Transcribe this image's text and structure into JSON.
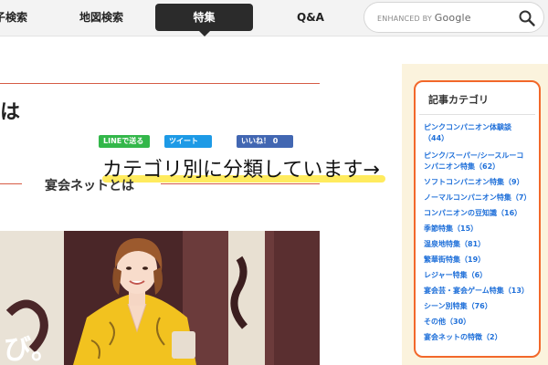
{
  "nav": {
    "items": [
      "子検索",
      "地図検索",
      "特集",
      "Q&A"
    ],
    "active": "特集"
  },
  "search": {
    "label_prefix": "ENHANCED BY",
    "label_brand": "Google",
    "icon": "search-icon"
  },
  "article": {
    "title_fragment": "は",
    "sns": {
      "line": "LINEで送る",
      "tweet": "ツイート",
      "like": "いいね！ 0"
    },
    "section_heading": "宴会ネットとは",
    "photo_text": "び。"
  },
  "annotation": {
    "text": "カテゴリ別に分類しています→",
    "highlight_color": "#ffe94d"
  },
  "sidebar": {
    "title": "記事カテゴリ",
    "border_color": "#f2682a",
    "categories": [
      {
        "line1": "ピンクコンパニオン体験談",
        "line2": "（44）"
      },
      {
        "line1": "ピンク/スーパー/シースルーコ",
        "line2": "ンパニオン特集（62）"
      },
      {
        "line1": "ソフトコンパニオン特集（9）"
      },
      {
        "line1": "ノーマルコンパニオン特集（7）"
      },
      {
        "line1": "コンパニオンの豆知識（16）"
      },
      {
        "line1": "季節特集（15）"
      },
      {
        "line1": "温泉地特集（81）"
      },
      {
        "line1": "繁華街特集（19）"
      },
      {
        "line1": "レジャー特集（6）"
      },
      {
        "line1": "宴会芸・宴会ゲーム特集（13）"
      },
      {
        "line1": "シーン別特集（76）"
      },
      {
        "line1": "その他（30）"
      },
      {
        "line1": "宴会ネットの特徴（2）"
      }
    ]
  }
}
